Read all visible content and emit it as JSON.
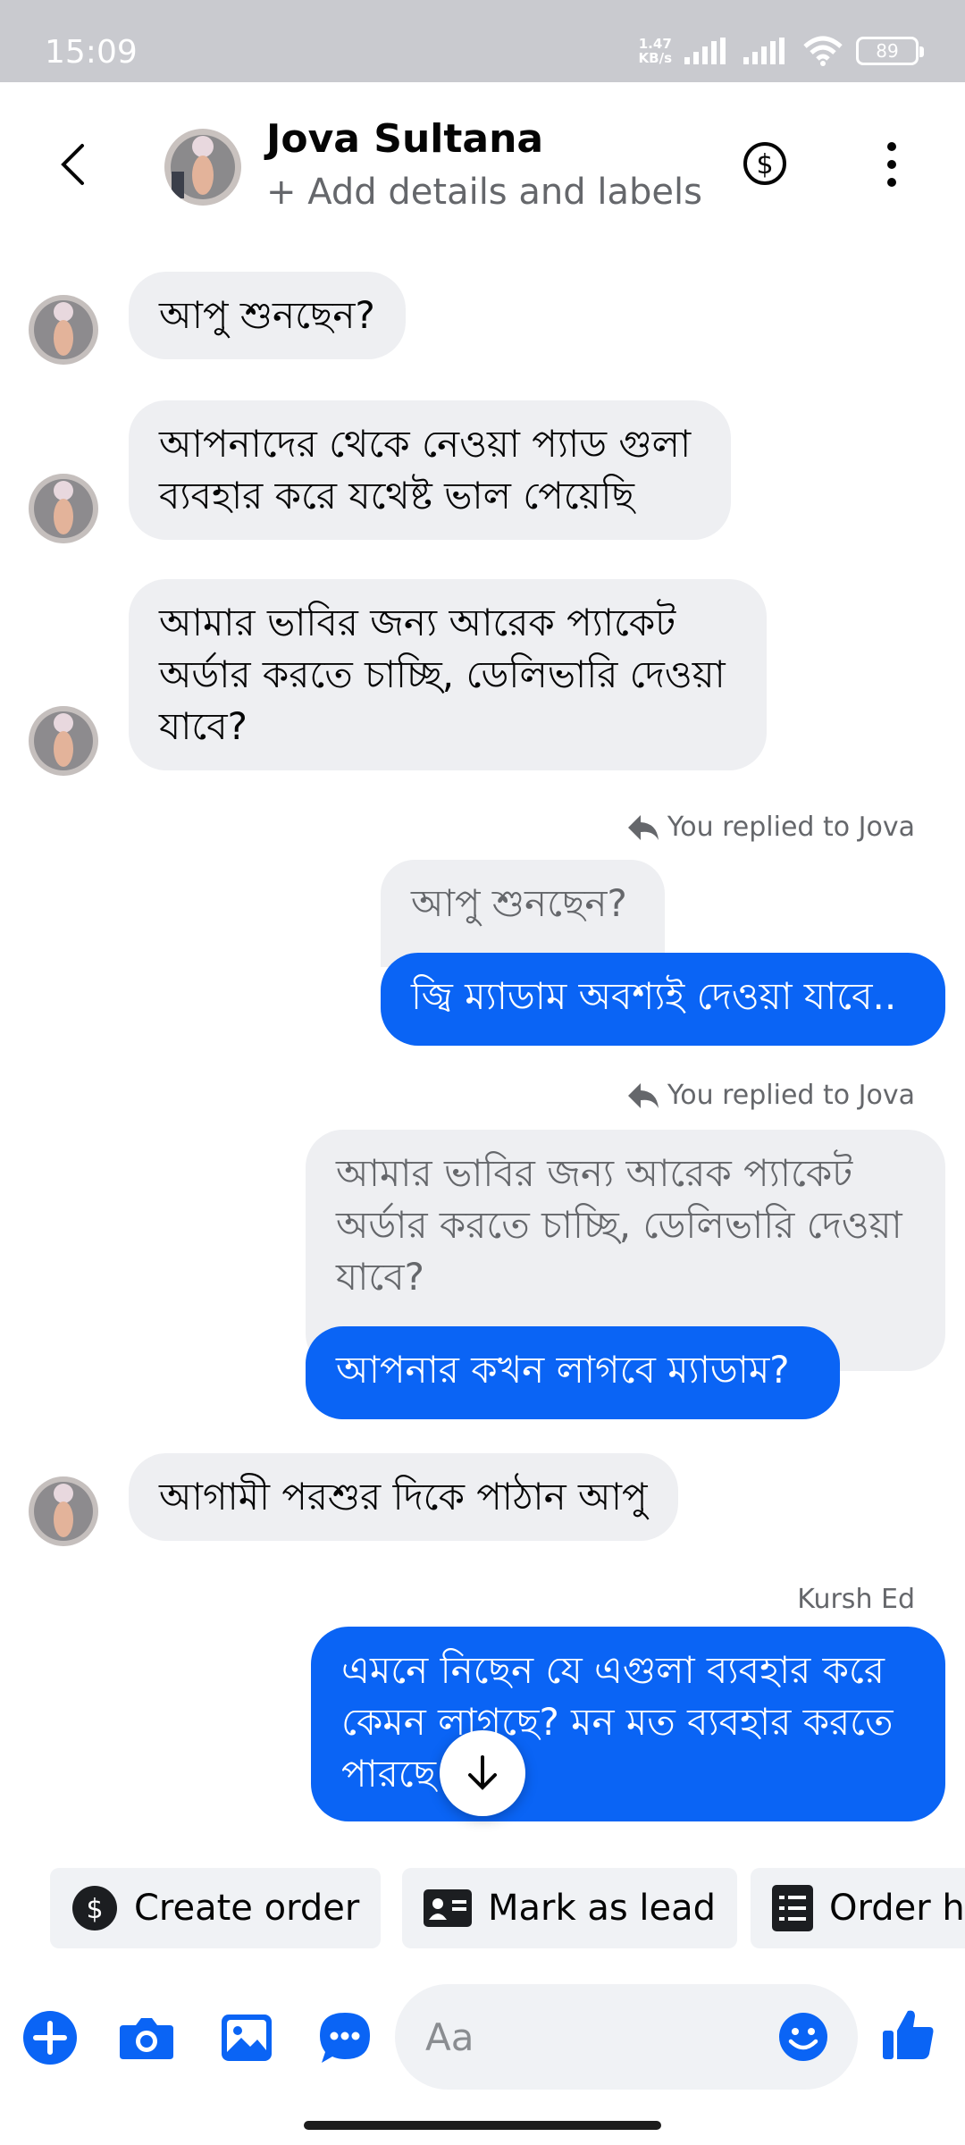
{
  "status_bar": {
    "time": "15:09",
    "net_speed_value": "1.47",
    "net_speed_unit": "KB/s",
    "battery": "89"
  },
  "header": {
    "name": "Jova Sultana",
    "subtitle": "+ Add details and labels"
  },
  "messages": [
    {
      "id": "m1",
      "type": "incoming",
      "text": "আপু শুনছেন?"
    },
    {
      "id": "m2",
      "type": "incoming",
      "text": "আপনাদের থেকে নেওয়া প্যাড গুলা ব্যবহার করে যথেষ্ট ভাল পেয়েছি"
    },
    {
      "id": "m3",
      "type": "incoming",
      "text": "আমার ভাবির জন্য আরেক প্যাকেট অর্ডার করতে চাচ্ছি, ডেলিভারি দেওয়া যাবে?"
    },
    {
      "id": "m4",
      "type": "outgoing-reply",
      "reply_label": "You replied to Jova",
      "quoted": "আপু শুনছেন?",
      "text": "জ্বি ম্যাডাম অবশ্যই দেওয়া যাবে.."
    },
    {
      "id": "m5",
      "type": "outgoing-reply",
      "reply_label": "You replied to Jova",
      "quoted": "আমার ভাবির জন্য আরেক প্যাকেট অর্ডার করতে চাচ্ছি, ডেলিভারি দেওয়া যাবে?",
      "text": "আপনার কখন লাগবে ম্যাডাম?"
    },
    {
      "id": "m6",
      "type": "incoming",
      "text": "আগামী পরশুর দিকে পাঠান আপু"
    },
    {
      "id": "m7",
      "type": "outgoing",
      "sender": "Kursh Ed",
      "text": "এমনে নিছেন যে এগুলা ব্যবহার করে কেমন লাগছে? মন মত ব্যবহার করতে পারছে"
    }
  ],
  "quick_actions": [
    {
      "label": "Create order",
      "icon": "dollar-circle-icon"
    },
    {
      "label": "Mark as lead",
      "icon": "id-card-icon"
    },
    {
      "label": "Order h",
      "icon": "receipt-list-icon"
    }
  ],
  "composer": {
    "placeholder": "Aa"
  },
  "colors": {
    "accent": "#0a64f5",
    "incoming_bubble": "#eeeff2",
    "status_bar": "#c9cacf"
  }
}
